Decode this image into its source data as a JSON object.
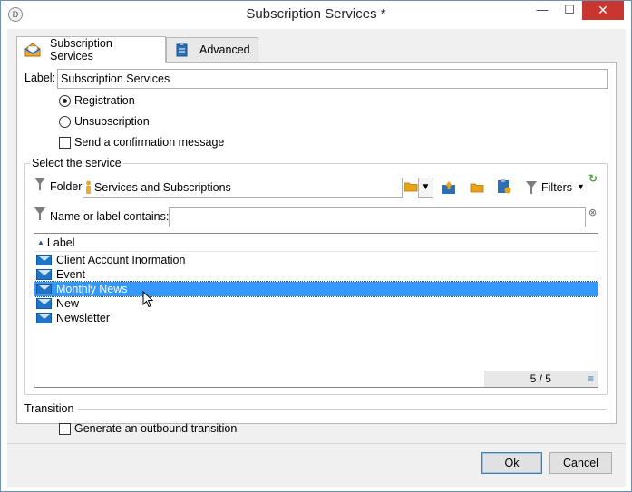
{
  "window": {
    "title": "Subscription Services *",
    "app_icon_glyph": "Ꭰ",
    "minimize_glyph": "—",
    "maximize_glyph": "☐",
    "close_glyph": "✕"
  },
  "tabs": [
    {
      "label": "Subscription Services",
      "icon": "envelope-open-icon",
      "active": true
    },
    {
      "label": "Advanced",
      "icon": "clipboard-icon",
      "active": false
    }
  ],
  "form": {
    "label_caption": "Label:",
    "label_value": "Subscription Services",
    "options": {
      "registration": "Registration",
      "unsubscription": "Unsubscription",
      "send_confirmation": "Send a confirmation message",
      "selected": "registration",
      "send_confirmation_checked": false
    }
  },
  "select_service": {
    "group_title": "Select the service",
    "folder_caption": "Folder:",
    "folder_value": "Services and Subscriptions",
    "filters_label": "Filters",
    "name_filter_caption": "Name or label contains:",
    "name_filter_value": "",
    "list": {
      "column_header": "Label",
      "rows": [
        {
          "label": "Client Account Inormation",
          "selected": false
        },
        {
          "label": "Event",
          "selected": false
        },
        {
          "label": "Monthly News",
          "selected": true
        },
        {
          "label": "New",
          "selected": false
        },
        {
          "label": "Newsletter",
          "selected": false
        }
      ],
      "count": "5 / 5"
    }
  },
  "transition": {
    "group_title": "Transition",
    "generate_outbound": "Generate an outbound transition",
    "generate_outbound_checked": false
  },
  "buttons": {
    "ok": "Ok",
    "cancel": "Cancel"
  },
  "colors": {
    "selection": "#3399ff",
    "close_button": "#c7372f",
    "envelope": "#1f74c9",
    "folder": "#e8a317",
    "refresh": "#4aa832"
  }
}
